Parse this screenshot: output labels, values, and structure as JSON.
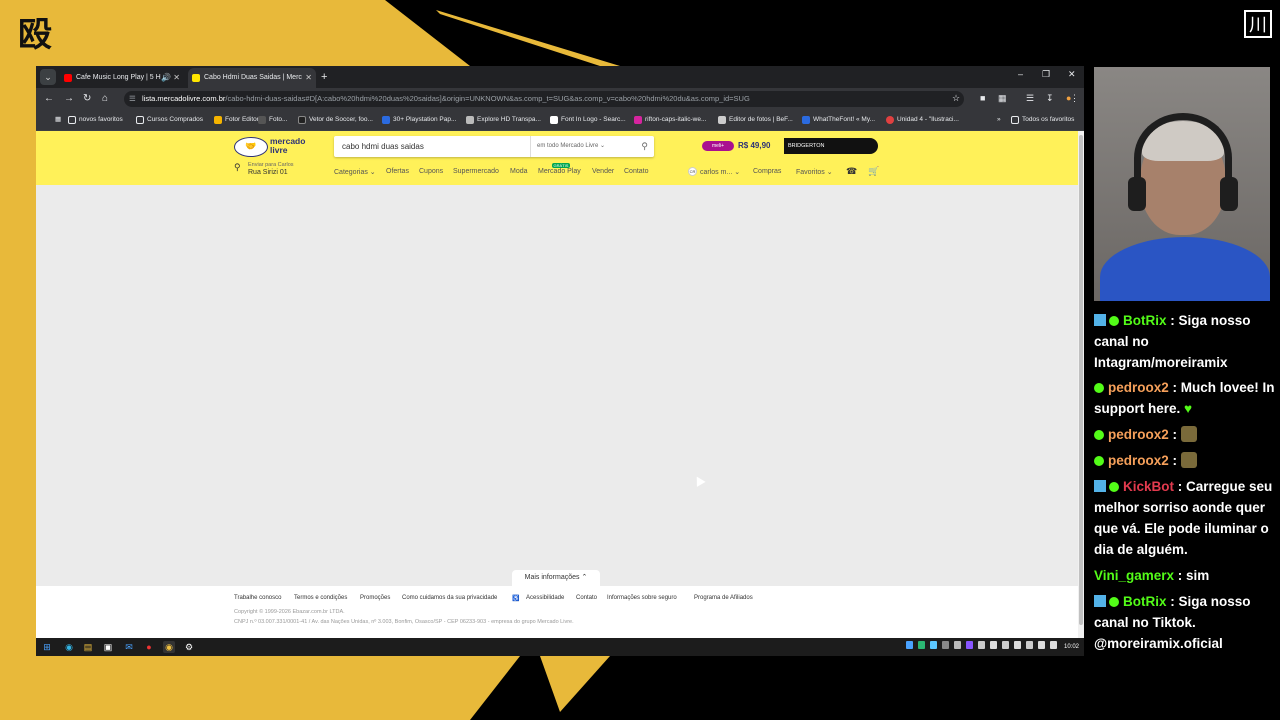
{
  "browser": {
    "tabs": [
      {
        "label": "Cafe Music Long Play | 5 H",
        "favicon_color": "#ff0000"
      },
      {
        "label": "Cabo Hdmi Duas Saidas | Merc",
        "favicon_color": "#ffe600"
      }
    ],
    "url_domain": "lista.mercadolivre.com.br",
    "url_rest": "/cabo-hdmi-duas-saidas#D[A:cabo%20hdmi%20duas%20saidas]&origin=UNKNOWN&as.comp_t=SUG&as.comp_v=cabo%20hdmi%20du&as.comp_id=SUG",
    "bookmarks": [
      {
        "label": "novos favoritos",
        "color": "#e8eaed"
      },
      {
        "label": "Cursos Comprados",
        "color": "#e8eaed"
      },
      {
        "label": "Fotor Editor",
        "color": "#f5b400"
      },
      {
        "label": "Foto...",
        "color": "#e8eaed"
      },
      {
        "label": "Vetor de Soccer, foo...",
        "color": "#222222"
      },
      {
        "label": "30+ Playstation Pap...",
        "color": "#2b6be0"
      },
      {
        "label": "Explore HD Transpa...",
        "color": "#bbbbbb"
      },
      {
        "label": "Font In Logo - Searc...",
        "color": "#ffffff"
      },
      {
        "label": "rifton-caps-italic-we...",
        "color": "#d6249f"
      },
      {
        "label": "Editor de fotos | BeF...",
        "color": "#cccccc"
      },
      {
        "label": "WhatTheFont! « My...",
        "color": "#2b6be0"
      },
      {
        "label": "Unidad 4 - \"Ilustraci...",
        "color": "#e04040"
      }
    ],
    "all_bookmarks": "Todos os favoritos"
  },
  "ml": {
    "brand_line1": "mercado",
    "brand_line2": "livre",
    "search_query": "cabo hdmi duas saidas",
    "search_scope": "em todo Mercado Livre",
    "promo_meli": "meli+",
    "promo_price": "R$ 49,90",
    "promo_brand": "BRIDGERTON",
    "address_line1": "Enviar para Carlos",
    "address_line2": "Rua Sirizi 01",
    "nav": [
      "Categorias",
      "Ofertas",
      "Cupons",
      "Supermercado",
      "Moda",
      "Mercado Play",
      "Vender",
      "Contato"
    ],
    "new_badge": "GRÁTIS",
    "user_initials": "CR",
    "user": "carlos m...",
    "purchases": "Compras",
    "favorites": "Favoritos",
    "more_info": "Mais informações",
    "footer_links": [
      "Trabalhe conosco",
      "Termos e condições",
      "Promoções",
      "Como cuidamos da sua privacidade",
      "Acessibilidade",
      "Contato",
      "Informações sobre seguro",
      "Programa de Afiliados"
    ],
    "copyright": "Copyright © 1999-2026 Ebazar.com.br LTDA.",
    "cnpj": "CNPJ n.º 03.007.331/0001-41 / Av. das Nações Unidas, nº 3.003, Bonfim, Osasco/SP - CEP 06233-903 - empresa do grupo Mercado Livre."
  },
  "taskbar": {
    "clock": "10:02"
  },
  "chat": [
    {
      "badge": "kick",
      "user": "BotRix",
      "color": "#53fc18",
      "text": "Siga nosso canal no Intagram/moreiramix"
    },
    {
      "badge": "verified",
      "user": "pedroox2",
      "color": "#f6a05a",
      "text": "Much lovee! In support here.",
      "heart": "♥"
    },
    {
      "badge": "verified",
      "user": "pedroox2",
      "color": "#f6a05a",
      "text": ""
    },
    {
      "badge": "verified",
      "user": "pedroox2",
      "color": "#f6a05a",
      "text": ""
    },
    {
      "badge": "kick",
      "user": "KickBot",
      "color": "#e23a4e",
      "text": "Carregue seu melhor sorriso aonde quer que vá. Ele pode iluminar o dia de alguém."
    },
    {
      "badge": "none",
      "user": "Vini_gamerx",
      "color": "#53fc18",
      "text": "sim"
    },
    {
      "badge": "kick",
      "user": "BotRix",
      "color": "#53fc18",
      "text": "Siga nosso canal no Tiktok. @moreiramix.oficial"
    }
  ]
}
